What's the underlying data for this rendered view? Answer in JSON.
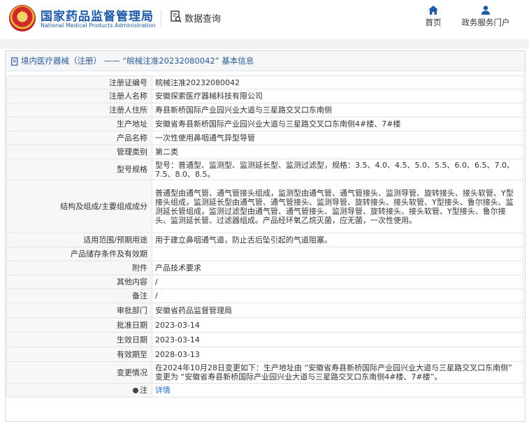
{
  "header": {
    "site_name_cn": "国家药品监督管理局",
    "site_name_en": "National Medical Products Administration",
    "data_query": "数据查询",
    "nav": {
      "home": "首页",
      "portal": "政务服务门户"
    }
  },
  "breadcrumb": "境内医疗器械（注册） —— “皖械注准20232080042” 基本信息",
  "rows": [
    {
      "key": "注册证编号",
      "value": "皖械注准20232080042"
    },
    {
      "key": "注册人名称",
      "value": "安徽探索医疗器械科技有限公司"
    },
    {
      "key": "注册人住所",
      "value": "寿县新桥国际产业园兴业大道与三星路交叉口东南侧"
    },
    {
      "key": "生产地址",
      "value": "安徽省寿县新桥国际产业园兴业大道与三星路交叉口东南侧4#楼、7#楼"
    },
    {
      "key": "产品名称",
      "value": "一次性使用鼻咽通气异型导管"
    },
    {
      "key": "管理类别",
      "value": "第二类"
    },
    {
      "key": "型号规格",
      "value": "型号：普通型、监测型、监测延长型、监测过滤型，规格：3.5、4.0、4.5、5.0、5.5、6.0、6.5、7.0、7.5、8.0、8.5。"
    },
    {
      "key": "结构及组成/主要组成成分",
      "value": "普通型由通气管、通气管接头组成，监测型由通气管、通气管接头、监测导管、旋转接头、接头软管、Y型接头组成，监测延长型由通气管、通气管接头、监测导管、旋转接头、接头软管、Y型接头、鲁尔接头、监测延长管组成，监测过滤型由通气管、通气管接头、监测导管、旋转接头、接头软管、Y型接头、鲁尔接头、监测延长管、过滤器组成。产品经环氧乙烷灭菌，应无菌，一次性使用。"
    },
    {
      "key": "适用范围/预期用途",
      "value": "用于建立鼻咽通气道，防止舌后坠引起的气道阻塞。"
    },
    {
      "key": "产品储存条件及有效期",
      "value": ""
    },
    {
      "key": "附件",
      "value": "产品技术要求"
    },
    {
      "key": "其他内容",
      "value": "/"
    },
    {
      "key": "备注",
      "value": "/"
    },
    {
      "key": "审批部门",
      "value": "安徽省药品监督管理局"
    },
    {
      "key": "批准日期",
      "value": "2023-03-14"
    },
    {
      "key": "生效日期",
      "value": "2023-03-14"
    },
    {
      "key": "有效期至",
      "value": "2028-03-13"
    },
    {
      "key": "变更情况",
      "value": "在2024年10月28日变更如下：生产地址由 “安徽省寿县新桥国际产业园兴业大道与三星路交叉口东南侧” 变更为 “安徽省寿县新桥国际产业园兴业大道与三星路交叉口东南侧4#楼、7#楼”。"
    }
  ],
  "note": {
    "key": "注",
    "link": "详情"
  },
  "colors": {
    "brand_blue": "#1e5aa8",
    "link_blue": "#1e6fd0",
    "label_bg": "#f7f7f7"
  }
}
